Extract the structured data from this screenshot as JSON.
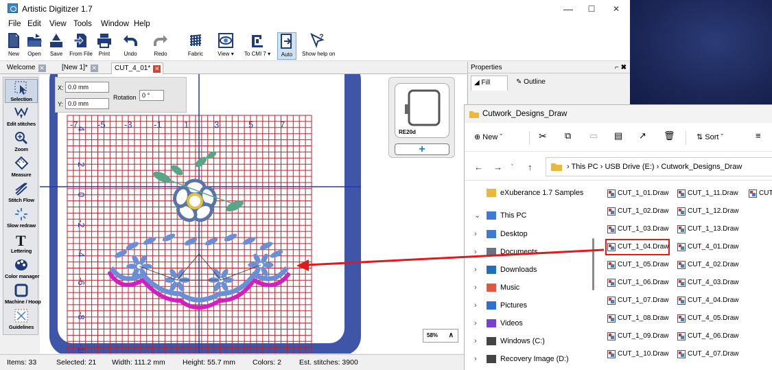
{
  "window": {
    "title": "Artistic Digitizer 1.7",
    "minimize": "—",
    "maximize": "☐",
    "close": "✕"
  },
  "menu": [
    "File",
    "Edit",
    "View",
    "Tools",
    "Window",
    "Help"
  ],
  "toolbar": {
    "new": "New",
    "open": "Open",
    "save": "Save",
    "from_file": "From File",
    "print": "Print",
    "undo": "Undo",
    "redo": "Redo",
    "fabric": "Fabric",
    "view": "View",
    "to_cmi": "To CMI 7",
    "auto": "Auto",
    "show_help": "Show help on"
  },
  "tabs": [
    {
      "label": "Welcome",
      "active": false
    },
    {
      "label": "[New 1]*",
      "active": false
    },
    {
      "label": "CUT_4_01*",
      "active": true
    }
  ],
  "palette": {
    "selection": "Selection",
    "edit_stitches": "Edit stitches",
    "zoom": "Zoom",
    "measure": "Measure",
    "stitch_flow": "Stitch Flow",
    "slow_redraw": "Slow redraw",
    "lettering": "Lettering",
    "color_manager": "Color manager",
    "machine_hoop": "Machine / Hoop",
    "guidelines": "Guidelines"
  },
  "transform": {
    "x_label": "X:",
    "x_value": "0.0 mm",
    "y_label": "Y:",
    "y_value": "0.0 mm",
    "rotation_label": "Rotation",
    "rotation_value": "0 °"
  },
  "ruler": {
    "x_ticks": [
      "-7",
      "-5",
      "-3",
      "-1",
      "1",
      "3",
      "5",
      "7"
    ],
    "y_ticks": [
      "4",
      "2",
      "0",
      "-2",
      "-4",
      "-6",
      "-8",
      "-10"
    ]
  },
  "hoop": {
    "name": "RE20d",
    "add": "+"
  },
  "zoom": {
    "value": "58%",
    "caret": "∧"
  },
  "status": {
    "items": "Items: 33",
    "selected": "Selected: 21",
    "width": "Width: 111.2 mm",
    "height": "Height: 55.7 mm",
    "colors": "Colors: 2",
    "stitches": "Est. stitches: 3900"
  },
  "properties": {
    "title": "Properties",
    "pin": "⌐",
    "close": "✖",
    "tab_fill": "Fill",
    "tab_outline": "Outline"
  },
  "explorer": {
    "title": "Cutwork_Designs_Draw",
    "commands": {
      "new": "New",
      "sort": "Sort"
    },
    "breadcrumb": [
      "This PC",
      "USB Drive (E:)",
      "Cutwork_Designs_Draw"
    ],
    "nav": [
      {
        "label": "eXuberance 1.7 Samples",
        "chev": "",
        "icon": "folder-icon"
      },
      {
        "label": "This PC",
        "chev": "⌄",
        "icon": "pc-icon"
      },
      {
        "label": "Desktop",
        "chev": "›",
        "icon": "desktop-icon"
      },
      {
        "label": "Documents",
        "chev": "›",
        "icon": "documents-icon"
      },
      {
        "label": "Downloads",
        "chev": "›",
        "icon": "downloads-icon"
      },
      {
        "label": "Music",
        "chev": "›",
        "icon": "music-icon"
      },
      {
        "label": "Pictures",
        "chev": "›",
        "icon": "pictures-icon"
      },
      {
        "label": "Videos",
        "chev": "›",
        "icon": "videos-icon"
      },
      {
        "label": "Windows (C:)",
        "chev": "›",
        "icon": "drive-icon"
      },
      {
        "label": "Recovery Image (D:)",
        "chev": "›",
        "icon": "recovery-drive-icon"
      }
    ],
    "files_col1": [
      "CUT_1_01.Draw",
      "CUT_1_02.Draw",
      "CUT_1_03.Draw",
      "CUT_1_04.Draw",
      "CUT_1_05.Draw",
      "CUT_1_06.Draw",
      "CUT_1_07.Draw",
      "CUT_1_08.Draw",
      "CUT_1_09.Draw",
      "CUT_1_10.Draw"
    ],
    "files_col2": [
      "CUT_1_11.Draw",
      "CUT_1_12.Draw",
      "CUT_1_13.Draw",
      "CUT_4_01.Draw",
      "CUT_4_02.Draw",
      "CUT_4_03.Draw",
      "CUT_4_04.Draw",
      "CUT_4_05.Draw",
      "CUT_4_06.Draw",
      "CUT_4_07.Draw"
    ],
    "files_col3": [
      "CUT"
    ],
    "selected_file": "CUT_1_04.Draw"
  },
  "colors": {
    "grid": "#c0202a",
    "axis": "#2b35b8",
    "hoop": "#3e55a8",
    "flower_blue": "#6b8fd6",
    "magenta": "#d020c0",
    "highlight": "#e0191a"
  }
}
